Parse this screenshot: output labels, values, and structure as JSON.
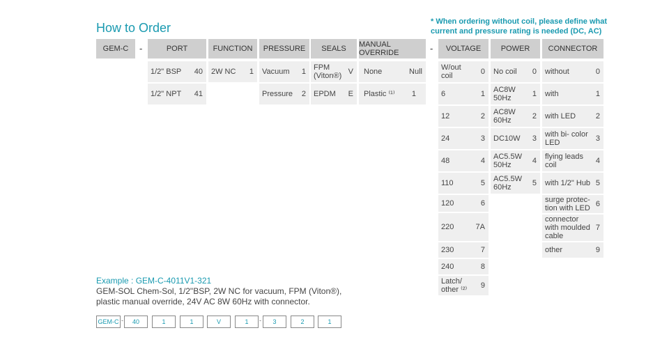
{
  "title": "How to Order",
  "note": "* When ordering without coil, please define what current and pressure rating is needed (DC, AC)",
  "prefix": "GEM-C",
  "dash": "-",
  "headers": {
    "port": "PORT",
    "function": "FUNCTION",
    "pressure": "PRESSURE",
    "seals": "SEALS",
    "override": "MANUAL OVERRIDE",
    "voltage": "VOLTAGE",
    "power": "POWER",
    "connector": "CONNECTOR"
  },
  "port": [
    {
      "label": "1/2\" BSP",
      "code": "40"
    },
    {
      "label": "1/2\" NPT",
      "code": "41"
    }
  ],
  "function": [
    {
      "label": "2W NC",
      "code": "1"
    }
  ],
  "pressure": [
    {
      "label": "Vacuum",
      "code": "1"
    },
    {
      "label": "Pressure",
      "code": "2"
    }
  ],
  "seals": [
    {
      "label": "FPM (Viton®)",
      "code": "V"
    },
    {
      "label": "EPDM",
      "code": "E"
    }
  ],
  "override": [
    {
      "label": "None",
      "code": "Null"
    },
    {
      "label": "Plastic ⁽¹⁾",
      "code": "1"
    }
  ],
  "voltage": [
    {
      "label": "W/out coil",
      "code": "0"
    },
    {
      "label": "6",
      "code": "1"
    },
    {
      "label": "12",
      "code": "2"
    },
    {
      "label": "24",
      "code": "3"
    },
    {
      "label": "48",
      "code": "4"
    },
    {
      "label": "110",
      "code": "5"
    },
    {
      "label": "120",
      "code": "6"
    },
    {
      "label": "220",
      "code": "7A"
    },
    {
      "label": "230",
      "code": "7"
    },
    {
      "label": "240",
      "code": "8"
    },
    {
      "label": "Latch/ other ⁽²⁾",
      "code": "9"
    }
  ],
  "power": [
    {
      "label": "No coil",
      "code": "0"
    },
    {
      "label": "AC8W 50Hz",
      "code": "1"
    },
    {
      "label": "AC8W 60Hz",
      "code": "2"
    },
    {
      "label": "DC10W",
      "code": "3"
    },
    {
      "label": "AC5.5W 50Hz",
      "code": "4"
    },
    {
      "label": "AC5.5W 60Hz",
      "code": "5"
    }
  ],
  "connector": [
    {
      "label": "without",
      "code": "0"
    },
    {
      "label": "with",
      "code": "1"
    },
    {
      "label": "with LED",
      "code": "2"
    },
    {
      "label": "with bi- color LED",
      "code": "3"
    },
    {
      "label": "flying leads coil",
      "code": "4"
    },
    {
      "label": "with 1/2\" Hub",
      "code": "5"
    },
    {
      "label": "surge protec- tion with LED",
      "code": "6"
    },
    {
      "label": "connector with moulded cable",
      "code": "7"
    },
    {
      "label": "other",
      "code": "9"
    }
  ],
  "example": {
    "title": "Example : GEM-C-4011V1-321",
    "text": "GEM-SOL Chem-Sol, 1/2\"BSP, 2W NC for vacuum, FPM (Viton®), plastic manual override, 24V AC 8W 60Hz with connector.",
    "boxes": [
      "GEM-C",
      "40",
      "1",
      "1",
      "V",
      "1",
      "3",
      "2",
      "1"
    ]
  }
}
